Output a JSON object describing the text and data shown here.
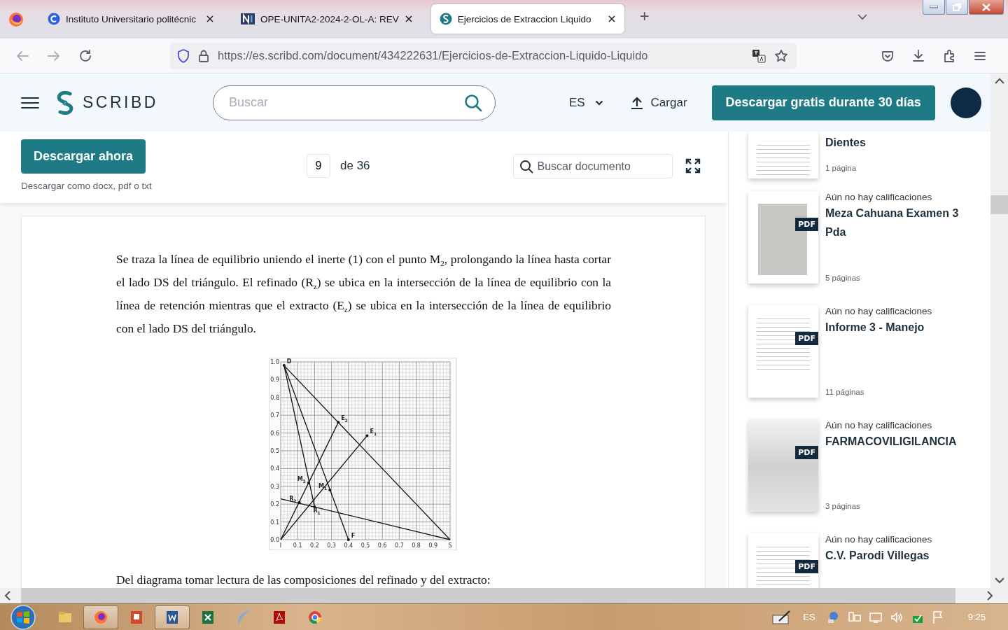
{
  "browser": {
    "tabs": [
      {
        "title": "Instituto Universitario politécnic",
        "selected": false
      },
      {
        "title": "OPE-UNITA2-2024-2-OL-A: REV",
        "selected": false
      },
      {
        "title": "Ejercicios de Extraccion Liquido",
        "selected": true
      }
    ],
    "new_tab": "+",
    "url": "https://es.scribd.com/document/434222631/Ejercicios-de-Extraccion-Liquido-Liquido"
  },
  "header": {
    "logo": "SCRIBD",
    "search_placeholder": "Buscar",
    "language": "ES",
    "upload": "Cargar",
    "cta": "Descargar gratis durante 30 días"
  },
  "toolbar": {
    "download_button": "Descargar ahora",
    "download_note": "Descargar como docx, pdf o txt",
    "page": "9",
    "page_total": "de 36",
    "doc_search_placeholder": "Buscar documento"
  },
  "document": {
    "paragraph": "Se traza la línea de equilibrio uniendo el inerte (1) con el punto M$_{2}$, prolongando la línea hasta cortar el lado DS del triángulo. El refinado (R$_{z}$) se ubica en la intersección de la línea de equilibrio con la línea de retención mientras que el extracto (E$_{z}$) se ubica en la intersección de la línea de equilibrio con el lado DS del triángulo.",
    "chart_data": {
      "type": "line",
      "grid": true,
      "xlim": [
        0,
        1
      ],
      "ylim": [
        0,
        1
      ],
      "xticks": [
        {
          "value": 0,
          "label": "I"
        },
        0.1,
        0.2,
        0.3,
        0.4,
        0.5,
        0.6,
        0.7,
        0.8,
        0.9,
        {
          "value": 1,
          "label": "S"
        }
      ],
      "yticks": [
        {
          "value": 0,
          "label": "0.0"
        },
        0.1,
        0.2,
        0.3,
        0.4,
        0.5,
        0.6,
        0.7,
        0.8,
        0.9,
        {
          "value": 1,
          "label": "1.0"
        }
      ],
      "series": [
        {
          "x": [
            0.02,
            1
          ],
          "values": [
            0.98,
            0
          ]
        },
        {
          "x": [
            0.02,
            0.4
          ],
          "values": [
            0.98,
            0
          ]
        },
        {
          "x": [
            0.02,
            0.2
          ],
          "values": [
            0.98,
            0.185
          ]
        },
        {
          "x": [
            0,
            0.34
          ],
          "values": [
            0,
            0.66
          ]
        },
        {
          "x": [
            0,
            0.51
          ],
          "values": [
            0,
            0.585
          ]
        },
        {
          "x": [
            0,
            1
          ],
          "values": [
            0.23,
            0
          ]
        }
      ],
      "annotations": [
        {
          "text": "D",
          "x": 0.02,
          "y": 0.98
        },
        {
          "text": "E$_{2}$",
          "x": 0.34,
          "y": 0.66
        },
        {
          "text": "E$_{1}$",
          "x": 0.51,
          "y": 0.585
        },
        {
          "text": "M$_{2}$",
          "x": 0.165,
          "y": 0.32
        },
        {
          "text": "M$_{1}$",
          "x": 0.29,
          "y": 0.28
        },
        {
          "text": "R$_{2}$",
          "x": 0.11,
          "y": 0.21
        },
        {
          "text": "R$_{1}$",
          "x": 0.2,
          "y": 0.185
        },
        {
          "text": "F",
          "x": 0.4,
          "y": 0
        }
      ]
    },
    "closing": "Del diagrama tomar lectura de las composiciones del refinado y del extracto:"
  },
  "sidebar": {
    "items": [
      {
        "title": "Dientes",
        "pages": "1 página"
      },
      {
        "rating": "Aún no hay calificaciones",
        "title": "Meza Cahuana Examen 3 Pda",
        "pages": "5 páginas",
        "badge": "PDF"
      },
      {
        "rating": "Aún no hay calificaciones",
        "title": "Informe 3 - Manejo",
        "pages": "11 páginas",
        "badge": "PDF"
      },
      {
        "rating": "Aún no hay calificaciones",
        "title": "FARMACOVILIGILANCIA",
        "pages": "3 páginas",
        "badge": "PDF"
      },
      {
        "rating": "Aún no hay calificaciones",
        "title": "C.V. Parodi Villegas",
        "badge": "PDF"
      }
    ]
  },
  "taskbar": {
    "apps": [
      {
        "kind": "folder",
        "open": false
      },
      {
        "kind": "firefox",
        "open": true
      },
      {
        "kind": "powerpoint",
        "open": false
      },
      {
        "kind": "word",
        "open": true
      },
      {
        "kind": "excel",
        "open": false
      },
      {
        "kind": "feather",
        "open": false
      },
      {
        "kind": "acrobat",
        "open": false
      },
      {
        "kind": "chrome",
        "open": false
      }
    ],
    "language": "ES",
    "time": "9:25"
  }
}
